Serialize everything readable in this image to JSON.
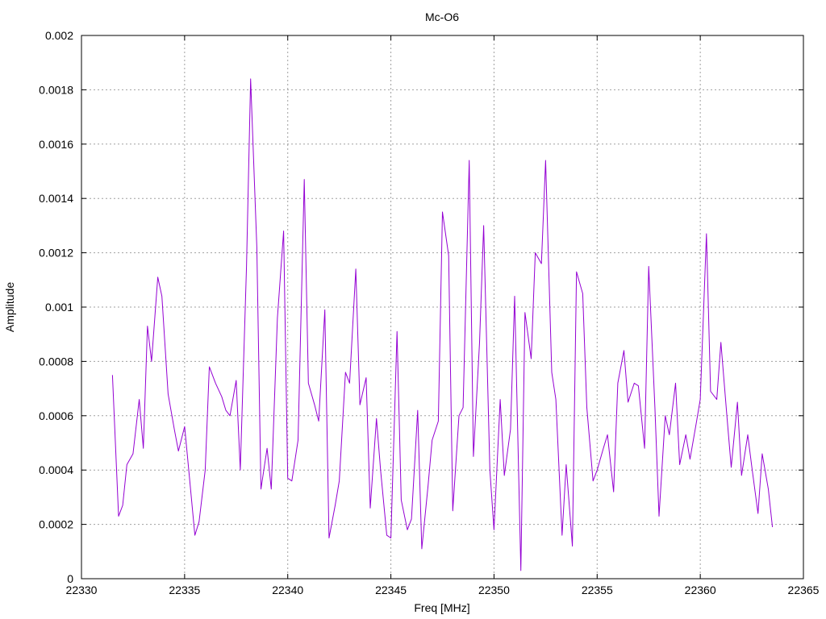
{
  "chart_data": {
    "type": "line",
    "title": "Mc-O6",
    "xlabel": "Freq [MHz]",
    "ylabel": "Amplitude",
    "xlim": [
      22330,
      22365
    ],
    "ylim": [
      0,
      0.002
    ],
    "xticks": [
      "22330",
      "22335",
      "22340",
      "22345",
      "22350",
      "22355",
      "22360",
      "22365"
    ],
    "yticks": [
      "0",
      "0.0002",
      "0.0004",
      "0.0006",
      "0.0008",
      "0.001",
      "0.0012",
      "0.0014",
      "0.0016",
      "0.0018",
      "0.002"
    ],
    "grid": true,
    "legend": "none",
    "series": [
      {
        "color": "#9400d3",
        "x": [
          22331.5,
          22331.8,
          22332.0,
          22332.2,
          22332.5,
          22332.8,
          22333.0,
          22333.2,
          22333.4,
          22333.7,
          22333.9,
          22334.2,
          22334.5,
          22334.7,
          22335.0,
          22335.2,
          22335.5,
          22335.7,
          22336.0,
          22336.2,
          22336.5,
          22336.8,
          22337.0,
          22337.2,
          22337.5,
          22337.7,
          22338.0,
          22338.2,
          22338.5,
          22338.7,
          22339.0,
          22339.2,
          22339.5,
          22339.8,
          22340.0,
          22340.2,
          22340.5,
          22340.8,
          22341.0,
          22341.3,
          22341.5,
          22341.8,
          22342.0,
          22342.3,
          22342.5,
          22342.8,
          22343.0,
          22343.3,
          22343.5,
          22343.8,
          22344.0,
          22344.3,
          22344.5,
          22344.8,
          22345.0,
          22345.3,
          22345.5,
          22345.8,
          22346.0,
          22346.3,
          22346.5,
          22346.8,
          22347.0,
          22347.3,
          22347.5,
          22347.8,
          22348.0,
          22348.3,
          22348.5,
          22348.8,
          22349.0,
          22349.3,
          22349.5,
          22349.8,
          22350.0,
          22350.3,
          22350.5,
          22350.8,
          22351.0,
          22351.3,
          22351.5,
          22351.8,
          22352.0,
          22352.3,
          22352.5,
          22352.8,
          22353.0,
          22353.3,
          22353.5,
          22353.8,
          22354.0,
          22354.3,
          22354.5,
          22354.8,
          22355.0,
          22355.3,
          22355.5,
          22355.8,
          22356.0,
          22356.3,
          22356.5,
          22356.8,
          22357.0,
          22357.3,
          22357.5,
          22357.8,
          22358.0,
          22358.3,
          22358.5,
          22358.8,
          22359.0,
          22359.3,
          22359.5,
          22359.8,
          22360.0,
          22360.3,
          22360.5,
          22360.8,
          22361.0,
          22361.3,
          22361.5,
          22361.8,
          22362.0,
          22362.3,
          22362.5,
          22362.8,
          22363.0,
          22363.3,
          22363.5
        ],
        "y": [
          0.00075,
          0.00023,
          0.00027,
          0.00042,
          0.00046,
          0.00066,
          0.00048,
          0.00093,
          0.0008,
          0.00111,
          0.00104,
          0.00068,
          0.00055,
          0.00047,
          0.00056,
          0.0004,
          0.00016,
          0.00021,
          0.0004,
          0.00078,
          0.00072,
          0.00067,
          0.00062,
          0.0006,
          0.00073,
          0.0004,
          0.00115,
          0.00184,
          0.00122,
          0.00033,
          0.00048,
          0.00033,
          0.00096,
          0.00128,
          0.00037,
          0.00036,
          0.00051,
          0.00147,
          0.00072,
          0.00064,
          0.00058,
          0.00099,
          0.00015,
          0.00027,
          0.00036,
          0.00076,
          0.00072,
          0.00114,
          0.00064,
          0.00074,
          0.00026,
          0.00059,
          0.0004,
          0.00016,
          0.00015,
          0.00091,
          0.00029,
          0.00018,
          0.00022,
          0.00062,
          0.00011,
          0.00034,
          0.00051,
          0.00058,
          0.00135,
          0.00119,
          0.00025,
          0.0006,
          0.00063,
          0.00154,
          0.00045,
          0.00087,
          0.0013,
          0.0004,
          0.00018,
          0.00066,
          0.00038,
          0.00055,
          0.00104,
          3e-05,
          0.00098,
          0.00081,
          0.0012,
          0.00116,
          0.00154,
          0.00076,
          0.00066,
          0.00016,
          0.00042,
          0.00012,
          0.00113,
          0.00105,
          0.00063,
          0.00036,
          0.0004,
          0.00048,
          0.00053,
          0.00032,
          0.00072,
          0.00084,
          0.00065,
          0.00072,
          0.00071,
          0.00048,
          0.00115,
          0.00063,
          0.00023,
          0.0006,
          0.00053,
          0.00072,
          0.00042,
          0.00053,
          0.00044,
          0.00057,
          0.00066,
          0.00127,
          0.00069,
          0.00066,
          0.00087,
          0.00059,
          0.00041,
          0.00065,
          0.00038,
          0.00053,
          0.00041,
          0.00024,
          0.00046,
          0.00033,
          0.00019
        ]
      }
    ]
  }
}
